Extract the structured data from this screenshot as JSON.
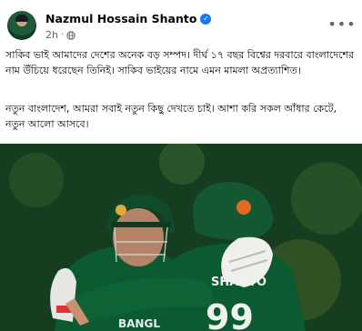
{
  "post": {
    "author": "Nazmul Hossain Shanto",
    "time": "2h",
    "meta_separator": "·",
    "paragraphs": [
      "সাকিব ভাই আমাদের দেশের অনেক বড় সম্পদ। দীর্ঘ ১৭ বছর বিশ্বের দরবারে বাংলাদেশের নাম উঁচিয়ে ধরেছেন তিনিই। সাকিব ভাইয়ের নামে এমন মামলা অপ্রত্যাশিত।",
      "নতুন বাংলাদেশ, আমরা সবাই নতুন কিছু দেখতে চাই। আশা করি সকল আঁধার কেটে, নতুন আলো আসবে।"
    ],
    "photo": {
      "jersey_name": "SHANTO",
      "jersey_number": "99",
      "jersey_text_left": "BANGL"
    }
  },
  "icons": {
    "verified": "verified-badge-icon",
    "audience": "globe-icon",
    "more": "more-options-icon"
  },
  "colors": {
    "verified_blue": "#1877f2",
    "jersey_green": "#0b5a32",
    "meta_gray": "#65676b"
  }
}
